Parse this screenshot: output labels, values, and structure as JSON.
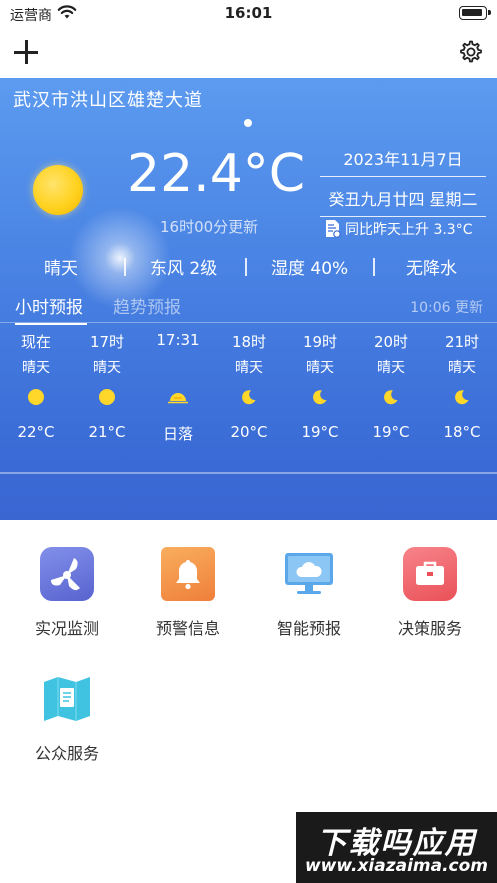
{
  "status_bar": {
    "carrier": "运营商",
    "time": "16:01"
  },
  "weather": {
    "location": "武汉市洪山区雄楚大道",
    "temperature": "22.4°C",
    "update_time": "16时00分更新",
    "date": "2023年11月7日",
    "lunar_date": "癸丑九月廿四 星期二",
    "compare_text": "同比昨天上升 3.3°C",
    "condition": "晴天",
    "wind": "东风 2级",
    "humidity": "湿度 40%",
    "precipitation": "无降水"
  },
  "tabs": {
    "hourly": "小时预报",
    "trend": "趋势预报",
    "updated": "10:06 更新"
  },
  "hourly": [
    {
      "time": "现在",
      "cond": "晴天",
      "icon": "sun-icon",
      "temp": "22°C"
    },
    {
      "time": "17时",
      "cond": "晴天",
      "icon": "sun-icon",
      "temp": "21°C"
    },
    {
      "time": "17:31",
      "cond": "",
      "icon": "sunset-icon",
      "temp": "日落"
    },
    {
      "time": "18时",
      "cond": "晴天",
      "icon": "moon-icon",
      "temp": "20°C"
    },
    {
      "time": "19时",
      "cond": "晴天",
      "icon": "moon-icon",
      "temp": "19°C"
    },
    {
      "time": "20时",
      "cond": "晴天",
      "icon": "moon-icon",
      "temp": "19°C"
    },
    {
      "time": "21时",
      "cond": "晴天",
      "icon": "moon-icon",
      "temp": "18°C"
    }
  ],
  "services": [
    {
      "label": "实况监测",
      "icon": "fan-icon",
      "color": "#6a74d8"
    },
    {
      "label": "预警信息",
      "icon": "bell-icon",
      "color": "#f5924a"
    },
    {
      "label": "智能预报",
      "icon": "monitor-cloud-icon",
      "color": "#5aa8ea"
    },
    {
      "label": "决策服务",
      "icon": "briefcase-icon",
      "color": "#f0646a"
    },
    {
      "label": "公众服务",
      "icon": "map-icon",
      "color": "#3fc3e0"
    }
  ],
  "watermark": {
    "line1": "下载吗应用",
    "line2": "www.xiazaima.com"
  }
}
